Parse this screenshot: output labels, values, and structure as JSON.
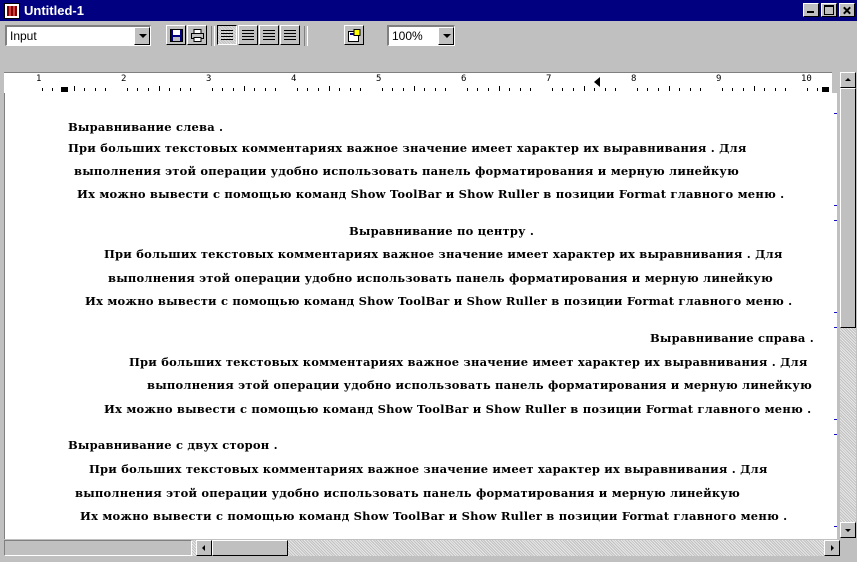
{
  "window": {
    "title": "Untitled-1"
  },
  "toolbar": {
    "style_value": "Input",
    "zoom_value": "100%",
    "icons": [
      "save-icon",
      "print-icon",
      "align-left-icon",
      "align-center-icon",
      "align-right-icon",
      "align-justify-icon",
      "properties-icon"
    ]
  },
  "ruler": {
    "numbers": [
      "1",
      "2",
      "3",
      "4",
      "5",
      "6",
      "7",
      "8",
      "9",
      "10"
    ]
  },
  "document": {
    "left": {
      "heading": "Выравнивание слева .",
      "line1": "При больших текстовых комментариях важное значение имеет характер их выравнивания . Для",
      "line2": "выполнения этой операции удобно использовать панель форматирования и мерную линейкую",
      "line3": "Их можно вывести с помощью команд Show ToolBar и Show Ruller в позиции Format главного меню ."
    },
    "center": {
      "heading": "Выравнивание по центру .",
      "line1": "При больших текстовых комментариях важное значение имеет характер их выравнивания . Для",
      "line2": "выполнения этой операции удобно использовать панель форматирования и мерную линейкую",
      "line3": "Их можно вывести с помощью команд Show ToolBar и Show Ruller в позиции Format главного меню ."
    },
    "right": {
      "heading": "Выравнивание справа .",
      "line1": "При больших текстовых комментариях важное значение имеет характер их выравнивания . Для",
      "line2": "выполнения этой операции удобно использовать панель форматирования и мерную линейкую",
      "line3": "Их можно вывести с помощью команд Show ToolBar и Show Ruller в позиции Format главного меню ."
    },
    "justify": {
      "heading": "Выравнивание с двух сторон .",
      "line1": "При больших текстовых комментариях важное значение имеет характер их выравнивания . Для",
      "line2": "выполнения этой операции удобно использовать панель форматирования и мерную линейкую",
      "line3": "Их можно вывести с помощью команд Show ToolBar и Show Ruller в позиции Format главного меню ."
    }
  },
  "colors": {
    "titlebar": "#000080",
    "bracket": "#1010c0"
  }
}
